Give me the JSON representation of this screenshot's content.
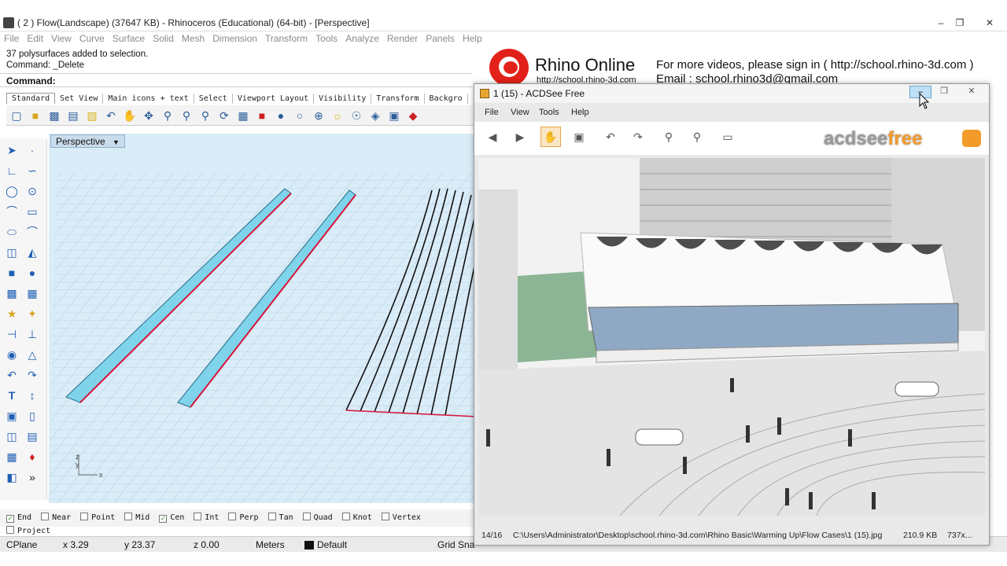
{
  "rhino": {
    "window_title": "( 2 ) Flow(Landscape) (37647 KB) - Rhinoceros (Educational) (64-bit) - [Perspective]",
    "menu": [
      "File",
      "Edit",
      "View",
      "Curve",
      "Surface",
      "Solid",
      "Mesh",
      "Dimension",
      "Transform",
      "Tools",
      "Analyze",
      "Render",
      "Panels",
      "Help"
    ],
    "command_history": [
      "37 polysurfaces added to selection.",
      "Command: _Delete"
    ],
    "command_prompt": "Command:",
    "toolbar_tabs": [
      "Standard",
      "Set View",
      "Main icons + text",
      "Select",
      "Viewport Layout",
      "Visibility",
      "Transform",
      "Backgro"
    ],
    "viewport_label": "Perspective",
    "osnaps": [
      {
        "label": "End",
        "checked": true
      },
      {
        "label": "Near",
        "checked": false
      },
      {
        "label": "Point",
        "checked": false
      },
      {
        "label": "Mid",
        "checked": false
      },
      {
        "label": "Cen",
        "checked": true
      },
      {
        "label": "Int",
        "checked": false
      },
      {
        "label": "Perp",
        "checked": false
      },
      {
        "label": "Tan",
        "checked": false
      },
      {
        "label": "Quad",
        "checked": false
      },
      {
        "label": "Knot",
        "checked": false
      },
      {
        "label": "Vertex",
        "checked": false
      },
      {
        "label": "Project",
        "checked": false
      }
    ],
    "status": {
      "cplane": "CPlane",
      "x": "x 3.29",
      "y": "y 23.37",
      "z": "z 0.00",
      "units": "Meters",
      "layer": "Default",
      "grid_snap": "Grid Sna"
    },
    "axis_labels": {
      "z": "z",
      "y": "y",
      "x": "x"
    }
  },
  "overlay": {
    "brand": "Rhino Online",
    "url": "http://school.rhino-3d.com",
    "more_videos": "For more videos, please  sign in ( http://school.rhino-3d.com )",
    "email": "Email : school.rhino3d@gmail.com"
  },
  "acdsee": {
    "title": "1 (15) - ACDSee Free",
    "menu": [
      "File",
      "View",
      "Tools",
      "Help"
    ],
    "logo_text": "acdsee",
    "logo_free": "free",
    "status": {
      "index": "14/16",
      "path": "C:\\Users\\Administrator\\Desktop\\school.rhino-3d.com\\Rhino Basic\\Warming Up\\Flow Cases\\1 (15).jpg",
      "size": "210.9 KB",
      "dims": "737x..."
    }
  },
  "colors": {
    "rhino_accent": "#1f5fb5",
    "curve_red": "#d8123a",
    "strip_cyan": "#7fd3ea",
    "logo_red": "#e2221a",
    "acdsee_orange": "#f39b2a"
  }
}
